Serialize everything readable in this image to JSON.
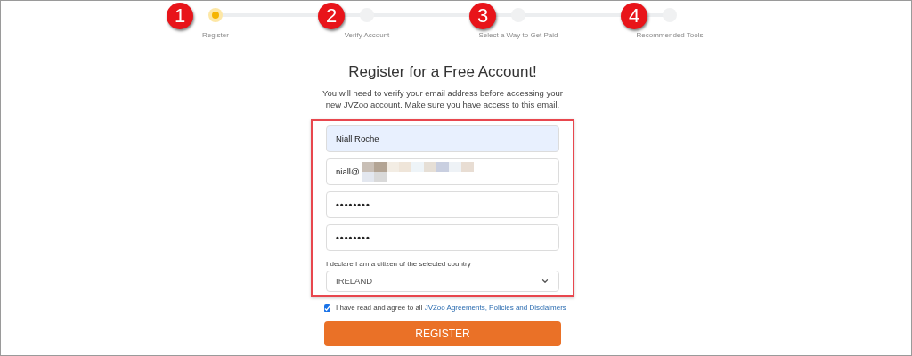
{
  "steps": [
    {
      "badge": "1",
      "label": "Register",
      "selected": true
    },
    {
      "badge": "2",
      "label": "Verify Account",
      "selected": false
    },
    {
      "badge": "3",
      "label": "Select a Way to Get Paid",
      "selected": false
    },
    {
      "badge": "4",
      "label": "Recommended Tools",
      "selected": false
    }
  ],
  "title": "Register for a Free Account!",
  "intro": "You will need to verify your email address before accessing your new JVZoo account.  Make sure you have access to this email.",
  "fields": [
    {
      "kind": "text",
      "value": "Niall Roche",
      "autofilled": true
    },
    {
      "kind": "email",
      "value": "niall@",
      "redacted": true,
      "autofilled": false
    },
    {
      "kind": "password",
      "value": "••••••••",
      "autofilled": false
    },
    {
      "kind": "password",
      "value": "••••••••",
      "autofilled": false
    }
  ],
  "country": {
    "label": "I declare I am a citizen of the selected country",
    "value": "IRELAND"
  },
  "agree": {
    "checked": true,
    "text": "I have read and agree to all",
    "link": "JVZoo Agreements, Policies and Disclaimers"
  },
  "submit": "REGISTER"
}
